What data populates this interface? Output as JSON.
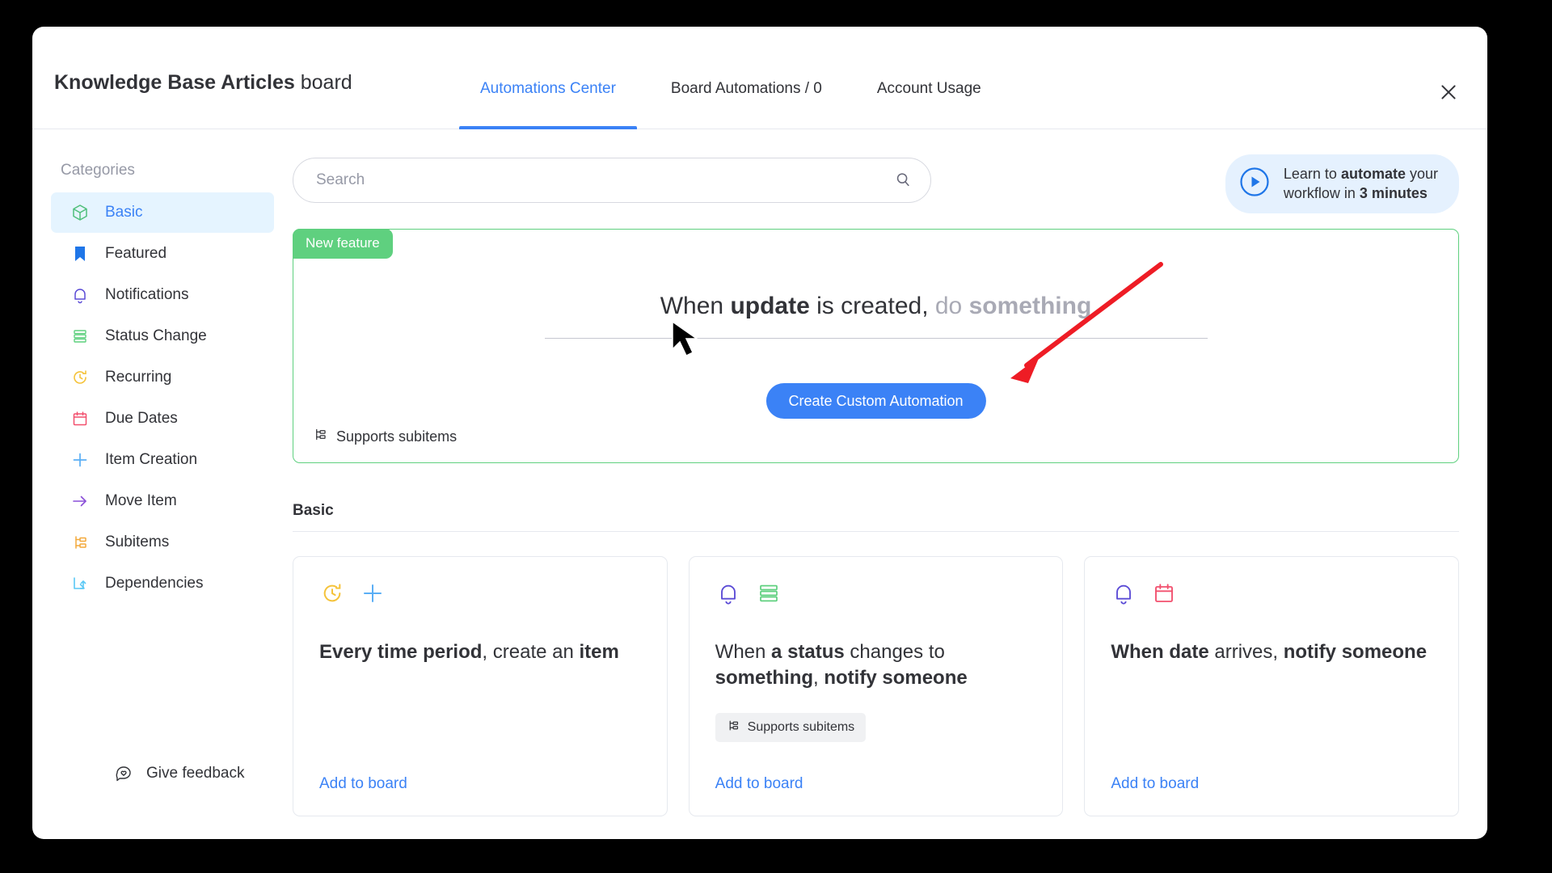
{
  "header": {
    "board_title_bold": "Knowledge Base Articles",
    "board_title_rest": " board",
    "tabs": [
      {
        "label": "Automations Center",
        "active": true
      },
      {
        "label": "Board Automations / 0",
        "active": false
      },
      {
        "label": "Account Usage",
        "active": false
      }
    ],
    "close_icon": "close-icon"
  },
  "sidebar": {
    "label": "Categories",
    "items": [
      {
        "label": "Basic",
        "icon": "cube-icon",
        "active": true
      },
      {
        "label": "Featured",
        "icon": "bookmark-icon",
        "active": false
      },
      {
        "label": "Notifications",
        "icon": "bell-icon",
        "active": false
      },
      {
        "label": "Status Change",
        "icon": "status-bars-icon",
        "active": false
      },
      {
        "label": "Recurring",
        "icon": "clock-arrow-icon",
        "active": false
      },
      {
        "label": "Due Dates",
        "icon": "calendar-icon",
        "active": false
      },
      {
        "label": "Item Creation",
        "icon": "plus-icon",
        "active": false
      },
      {
        "label": "Move Item",
        "icon": "arrow-right-icon",
        "active": false
      },
      {
        "label": "Subitems",
        "icon": "subitems-icon",
        "active": false
      },
      {
        "label": "Dependencies",
        "icon": "dependency-icon",
        "active": false
      }
    ],
    "feedback_label": "Give feedback",
    "feedback_icon": "feedback-heart-bubble-icon"
  },
  "search": {
    "value": "",
    "placeholder": "Search",
    "icon": "search-icon"
  },
  "video_banner": {
    "play_icon": "play-circle-icon",
    "line1_prefix": "Learn to ",
    "line1_bold": "automate",
    "line1_suffix": " your",
    "line2_prefix": "workflow in ",
    "line2_bold": "3 minutes"
  },
  "feature_card": {
    "badge": "New feature",
    "recipe": {
      "p1": "When ",
      "b1": "update",
      "p2": " is created, ",
      "p3": "do ",
      "b2": "something"
    },
    "button_label": "Create Custom Automation",
    "supports_subitems": "Supports subitems",
    "supports_icon": "subitems-icon"
  },
  "section": {
    "title": "Basic"
  },
  "cards": [
    {
      "icons": [
        "clock-arrow-icon",
        "plus-icon"
      ],
      "text_parts": [
        {
          "t": "Every time period",
          "bold": true
        },
        {
          "t": ", ",
          "bold": false
        },
        {
          "t": "create an ",
          "bold": false
        },
        {
          "t": "item",
          "bold": true
        }
      ],
      "chip": null,
      "add_label": "Add to board"
    },
    {
      "icons": [
        "bell-icon",
        "status-bars-icon"
      ],
      "text_parts": [
        {
          "t": "When ",
          "bold": false
        },
        {
          "t": "a status",
          "bold": true
        },
        {
          "t": " changes to ",
          "bold": false
        },
        {
          "t": "something",
          "bold": true
        },
        {
          "t": ", ",
          "bold": false
        },
        {
          "t": "notify someone",
          "bold": true
        }
      ],
      "chip": "Supports subitems",
      "add_label": "Add to board"
    },
    {
      "icons": [
        "bell-icon",
        "calendar-icon"
      ],
      "text_parts": [
        {
          "t": "When date",
          "bold": true
        },
        {
          "t": " arrives, ",
          "bold": false
        },
        {
          "t": "notify someone",
          "bold": true
        }
      ],
      "chip": null,
      "add_label": "Add to board"
    }
  ],
  "annotation": {
    "arrow_color": "#ee1c25"
  },
  "colors": {
    "accent_blue": "#3b82f6",
    "feature_green": "#5fd07f",
    "text": "#323338",
    "muted": "#9699a6"
  }
}
